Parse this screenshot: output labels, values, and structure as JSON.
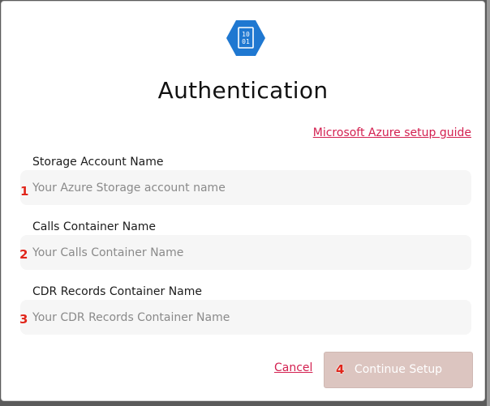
{
  "dialog": {
    "title": "Authentication",
    "logo_text_top": "10",
    "logo_text_bottom": "01",
    "guide_link": "Microsoft Azure setup guide"
  },
  "fields": [
    {
      "label": "Storage Account Name",
      "placeholder": "Your Azure Storage account name",
      "step": "1"
    },
    {
      "label": "Calls Container Name",
      "placeholder": "Your Calls Container Name",
      "step": "2"
    },
    {
      "label": "CDR Records Container Name",
      "placeholder": "Your CDR Records Container Name",
      "step": "3"
    }
  ],
  "actions": {
    "cancel_label": "Cancel",
    "continue_label": "Continue Setup",
    "continue_step": "4"
  },
  "colors": {
    "accent": "#d32050",
    "azure_blue": "#1f78d1",
    "button_disabled": "#dcc5c0",
    "step_badge": "#e0261b"
  },
  "icons": {
    "logo": "azure-storage-blob-icon"
  }
}
